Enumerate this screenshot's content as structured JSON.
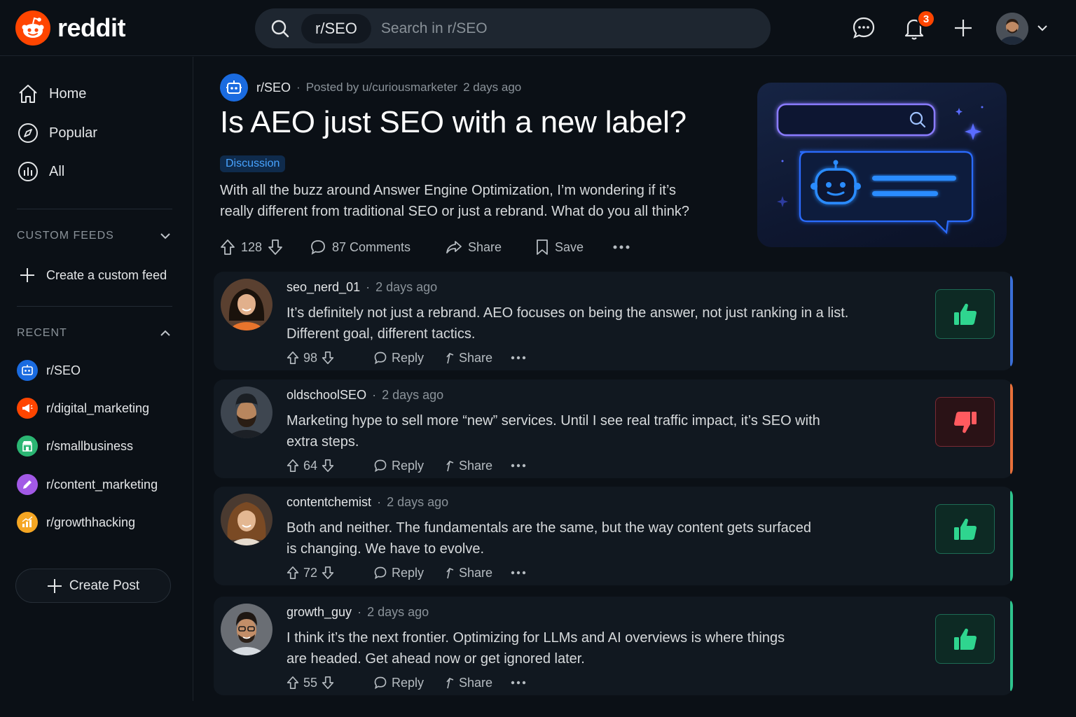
{
  "header": {
    "logo_text": "reddit",
    "search_chip": "r/SEO",
    "search_placeholder": "Search in r/SEO",
    "notification_count": "3"
  },
  "sidebar": {
    "nav": [
      {
        "label": "Home",
        "icon": "home-icon"
      },
      {
        "label": "Popular",
        "icon": "compass-icon"
      },
      {
        "label": "All",
        "icon": "all-icon"
      }
    ],
    "custom_feeds_label": "CUSTOM FEEDS",
    "create_feed_label": "Create a custom feed",
    "recent_label": "RECENT",
    "recent": [
      {
        "label": "r/SEO",
        "color": "#1a6be0"
      },
      {
        "label": "r/digital_marketing",
        "color": "#ff4500"
      },
      {
        "label": "r/smallbusiness",
        "color": "#2bb673"
      },
      {
        "label": "r/content_marketing",
        "color": "#a259e6"
      },
      {
        "label": "r/growthhacking",
        "color": "#f5a623"
      }
    ],
    "create_post_label": "Create Post"
  },
  "post": {
    "subreddit": "r/SEO",
    "posted_by": "Posted by u/curiousmarketer",
    "time": "2 days ago",
    "title": "Is AEO just SEO with a new label?",
    "flair": "Discussion",
    "body_line1": "With all the buzz around Answer Engine Optimization, I’m wondering if it’s",
    "body_line2": "really different from traditional SEO or just a rebrand. What do you all think?",
    "votes": "128",
    "comments_label": "87 Comments",
    "share_label": "Share",
    "save_label": "Save"
  },
  "comments": [
    {
      "user": "seo_nerd_01",
      "time": "2 days ago",
      "line1": "It’s definitely not just a rebrand. AEO focuses on being the answer, not just ranking in a list.",
      "line2": "Different goal, different tactics.",
      "votes": "98",
      "reply_label": "Reply",
      "share_label": "Share",
      "verdict": "thumbs-up",
      "accent": "#3a6fd8"
    },
    {
      "user": "oldschoolSEO",
      "time": "2 days ago",
      "line1": "Marketing hype to sell more “new” services. Until I see real traffic impact, it’s SEO with",
      "line2": "extra steps.",
      "votes": "64",
      "reply_label": "Reply",
      "share_label": "Share",
      "verdict": "thumbs-down",
      "accent": "#e8703a"
    },
    {
      "user": "contentchemist",
      "time": "2 days ago",
      "line1": "Both and neither. The fundamentals are the same, but the way content gets surfaced",
      "line2": "is changing. We have to evolve.",
      "votes": "72",
      "reply_label": "Reply",
      "share_label": "Share",
      "verdict": "thumbs-up",
      "accent": "#2fc48d"
    },
    {
      "user": "growth_guy",
      "time": "2 days ago",
      "line1": "I think it’s the next frontier. Optimizing for LLMs and AI overviews is where things",
      "line2": "are headed. Get ahead now or get ignored later.",
      "votes": "55",
      "reply_label": "Reply",
      "share_label": "Share",
      "verdict": "thumbs-up",
      "accent": "#2fc48d"
    }
  ],
  "colors": {
    "brand": "#ff4500",
    "upvote_green": "#2fd58f",
    "downvote_red": "#ff5a5f"
  }
}
